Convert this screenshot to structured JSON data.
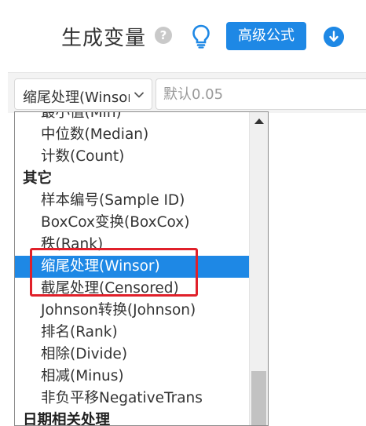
{
  "header": {
    "title": "生成变量",
    "help_icon": "?",
    "advanced_button": "高级公式"
  },
  "toolbar": {
    "select_value": "缩尾处理(Winsor)",
    "input_placeholder": "默认0.05"
  },
  "dropdown": {
    "partial_top_item": "最小值(Min)",
    "items": [
      {
        "type": "option",
        "label": "中位数(Median)"
      },
      {
        "type": "option",
        "label": "计数(Count)"
      },
      {
        "type": "group",
        "label": "其它"
      },
      {
        "type": "option",
        "label": "样本编号(Sample ID)"
      },
      {
        "type": "option",
        "label": "BoxCox变换(BoxCox)"
      },
      {
        "type": "option",
        "label": "秩(Rank)"
      },
      {
        "type": "option",
        "label": "缩尾处理(Winsor)",
        "selected": true
      },
      {
        "type": "option",
        "label": "截尾处理(Censored)"
      },
      {
        "type": "option",
        "label": "Johnson转换(Johnson)"
      },
      {
        "type": "option",
        "label": "排名(Rank)"
      },
      {
        "type": "option",
        "label": "相除(Divide)"
      },
      {
        "type": "option",
        "label": "相减(Minus)"
      },
      {
        "type": "option",
        "label": "非负平移NegativeTrans"
      },
      {
        "type": "group",
        "label": "日期相关处理"
      }
    ]
  },
  "colors": {
    "accent": "#1e88e5",
    "highlight": "#e0202a",
    "bulb": "#1e88e5"
  },
  "icons": {
    "help": "help-circle-icon",
    "bulb": "lightbulb-icon",
    "download": "download-circle-icon",
    "chevron": "chevron-down-icon",
    "scroll_up": "scroll-up-arrow-icon"
  }
}
